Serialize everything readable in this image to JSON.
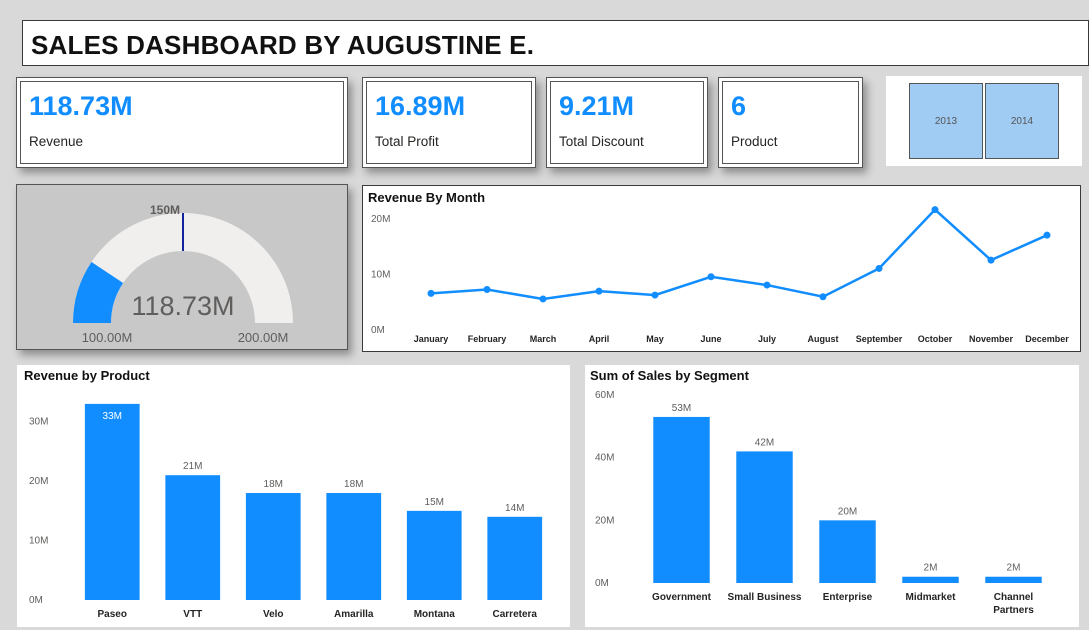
{
  "header": {
    "title": "SALES DASHBOARD BY AUGUSTINE E."
  },
  "kpis": [
    {
      "value": "118.73M",
      "label": "Revenue"
    },
    {
      "value": "16.89M",
      "label": "Total Profit"
    },
    {
      "value": "9.21M",
      "label": "Total Discount"
    },
    {
      "value": "6",
      "label": "Product"
    }
  ],
  "year_slicer": {
    "options": [
      "2013",
      "2014"
    ]
  },
  "gauge": {
    "value_label": "118.73M",
    "min_label": "100.00M",
    "max_label": "200.00M",
    "target_label": "150M",
    "value": 118.73,
    "min": 100,
    "max": 200,
    "target": 150,
    "colors": {
      "fill": "#118DFF",
      "track": "#F0EFEE",
      "target": "#12239E"
    }
  },
  "chart_data": [
    {
      "type": "line",
      "title": "Revenue By Month",
      "x": [
        "January",
        "February",
        "March",
        "April",
        "May",
        "June",
        "July",
        "August",
        "September",
        "October",
        "November",
        "December"
      ],
      "series": [
        {
          "values": [
            6.6,
            7.3,
            5.6,
            7.0,
            6.3,
            9.6,
            8.1,
            6.0,
            11.1,
            21.7,
            12.6,
            17.1
          ]
        }
      ],
      "yticks": [
        "0M",
        "10M",
        "20M"
      ],
      "ylim": [
        0,
        22
      ],
      "color": "#118DFF"
    },
    {
      "type": "bar",
      "title": "Revenue by Product",
      "categories": [
        "Paseo",
        "VTT",
        "Velo",
        "Amarilla",
        "Montana",
        "Carretera"
      ],
      "values": [
        33,
        21,
        18,
        18,
        15,
        14
      ],
      "data_labels": [
        "33M",
        "21M",
        "18M",
        "18M",
        "15M",
        "14M"
      ],
      "yticks": [
        "0M",
        "10M",
        "20M",
        "30M"
      ],
      "ylim": [
        0,
        35
      ],
      "color": "#118DFF"
    },
    {
      "type": "bar",
      "title": "Sum of Sales by Segment",
      "categories": [
        "Government",
        "Small Business",
        "Enterprise",
        "Midmarket",
        "Channel Partners"
      ],
      "values": [
        53,
        42,
        20,
        2,
        2
      ],
      "data_labels": [
        "53M",
        "42M",
        "20M",
        "2M",
        "2M"
      ],
      "yticks": [
        "0M",
        "20M",
        "40M",
        "60M"
      ],
      "ylim": [
        0,
        60
      ],
      "color": "#118DFF"
    }
  ]
}
